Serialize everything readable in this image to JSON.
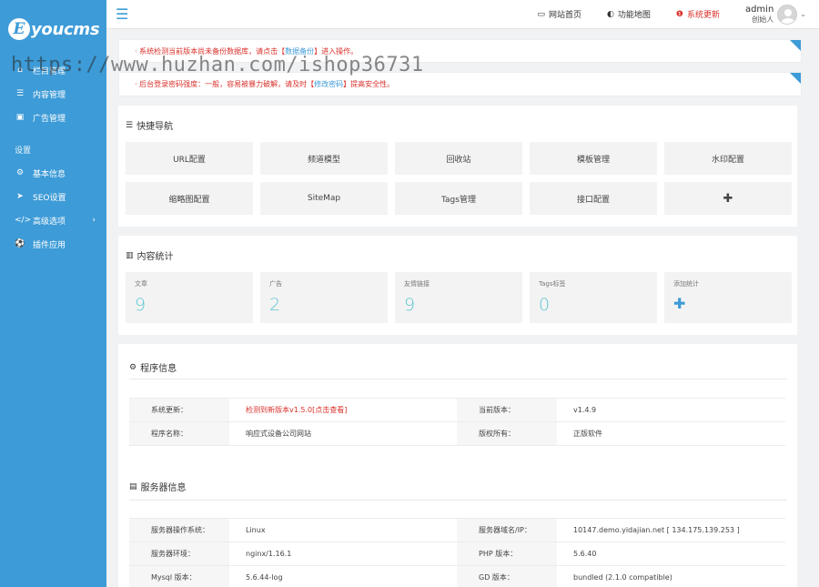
{
  "brand": {
    "logo_letter": "E",
    "logo_text": "youcms"
  },
  "sidebar": {
    "items": [
      {
        "label": "栏目管理",
        "icon": "home-icon"
      },
      {
        "label": "内容管理",
        "icon": "list-icon"
      },
      {
        "label": "广告管理",
        "icon": "image-icon"
      }
    ],
    "section_label": "设置",
    "settings": [
      {
        "label": "基本信息",
        "icon": "gear-icon"
      },
      {
        "label": "SEO设置",
        "icon": "paper-plane-icon"
      },
      {
        "label": "高级选项",
        "icon": "code-icon",
        "chevron": "›"
      },
      {
        "label": "插件应用",
        "icon": "soccer-icon"
      }
    ]
  },
  "topbar": {
    "menu_toggle": "☰",
    "links": [
      {
        "label": "网站首页",
        "icon": "monitor-icon"
      },
      {
        "label": "功能地图",
        "icon": "toggle-icon"
      },
      {
        "label": "系统更新",
        "icon": "info-icon"
      }
    ],
    "user": {
      "name": "admin",
      "role": "创始人"
    }
  },
  "notices": [
    {
      "pre": "· 系统检测当前版本尚未备份数据库，请点击【",
      "link": "数据备份",
      "post": "】进入操作。"
    },
    {
      "pre": "· 后台登录密码强度：一般，容易被暴力破解，请及时【",
      "link": "修改密码",
      "post": "】提高安全性。"
    }
  ],
  "quick_nav": {
    "title": "快捷导航",
    "items": [
      "URL配置",
      "频道模型",
      "回收站",
      "模板管理",
      "水印配置",
      "缩略图配置",
      "SiteMap",
      "Tags管理",
      "接口配置",
      "✚"
    ]
  },
  "stats": {
    "title": "内容统计",
    "items": [
      {
        "label": "文章",
        "value": "9"
      },
      {
        "label": "广告",
        "value": "2"
      },
      {
        "label": "友情链接",
        "value": "9"
      },
      {
        "label": "Tags标签",
        "value": "0"
      },
      {
        "label": "添加统计",
        "value": "✚"
      }
    ]
  },
  "program_info": {
    "title": "程序信息",
    "rows": [
      {
        "k1": "系统更新：",
        "v1": "检测到新版本v1.5.0[点击查看]",
        "k2": "当前版本：",
        "v2": "v1.4.9"
      },
      {
        "k1": "程序名称：",
        "v1": "响应式设备公司网站",
        "k2": "版权所有：",
        "v2": "正版软件"
      }
    ]
  },
  "server_info": {
    "title": "服务器信息",
    "rows": [
      {
        "k1": "服务器操作系统：",
        "v1": "Linux",
        "k2": "服务器域名/IP：",
        "v2": "10147.demo.yidajian.net [ 134.175.139.253 ]"
      },
      {
        "k1": "服务器环境：",
        "v1": "nginx/1.16.1",
        "k2": "PHP 版本：",
        "v2": "5.6.40"
      },
      {
        "k1": "Mysql 版本：",
        "v1": "5.6.44-log",
        "k2": "GD 版本：",
        "v2": "bundled (2.1.0 compatible)"
      }
    ]
  },
  "watermark": "https://www.huzhan.com/ishop36731",
  "colors": {
    "accent": "#3d9bd7",
    "danger": "#d9312b",
    "stat_value": "#5fc6d4"
  }
}
